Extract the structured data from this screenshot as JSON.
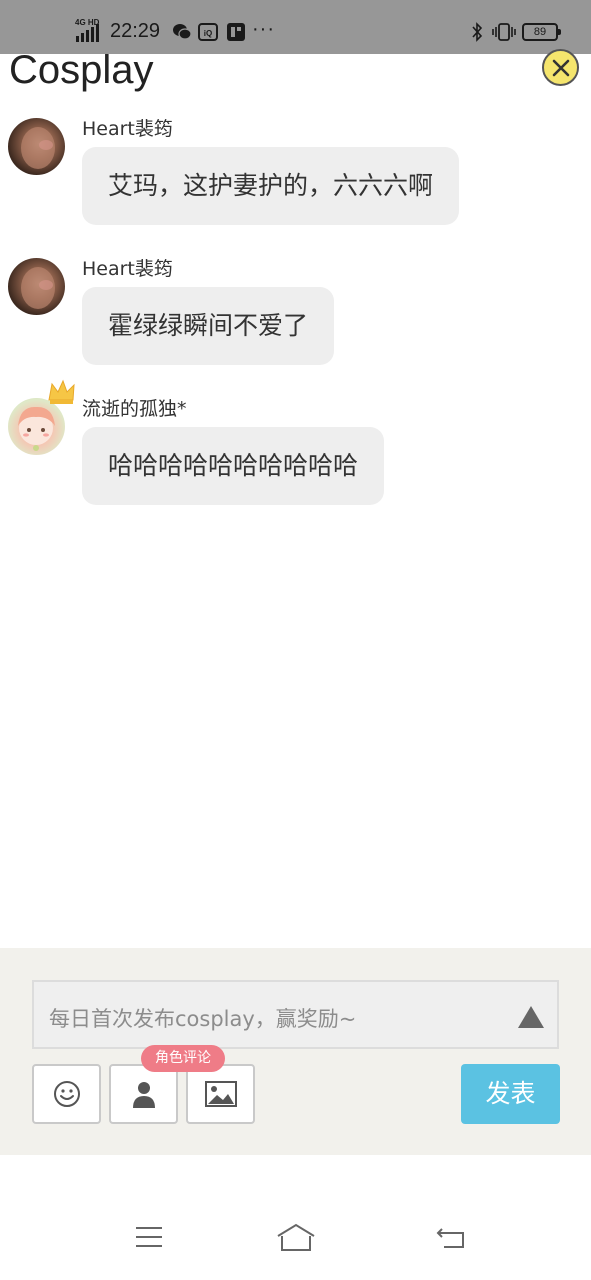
{
  "status_bar": {
    "network": "4G HD",
    "time": "22:29",
    "more": "···",
    "battery": "89",
    "app_icons": [
      "wechat-icon",
      "iqiyi-icon",
      "news-app-icon"
    ]
  },
  "header": {
    "title": "Cosplay"
  },
  "messages": [
    {
      "username": "Heart裴筠",
      "text": "艾玛，这护妻护的，六六六啊",
      "avatar": "photo-avatar"
    },
    {
      "username": "Heart裴筠",
      "text": "霍绿绿瞬间不爱了",
      "avatar": "photo-avatar"
    },
    {
      "username": "流逝的孤独*",
      "text": "哈哈哈哈哈哈哈哈哈哈",
      "avatar": "anime-avatar",
      "badge": "crown-icon"
    }
  ],
  "composer": {
    "placeholder": "每日首次发布cosplay，赢奖励~",
    "role_tip": "角色评论",
    "send_label": "发表",
    "tools": [
      "emoji-icon",
      "person-icon",
      "image-icon"
    ]
  },
  "colors": {
    "status_bar": "#979797",
    "bubble": "#eeeeee",
    "send_button": "#5bc2e2",
    "role_tip": "#ef7c87",
    "close_button": "#f5e56d",
    "composer_bg": "#f2f1ec"
  },
  "navbar": {
    "buttons": [
      "menu-icon",
      "home-icon",
      "back-icon"
    ]
  }
}
